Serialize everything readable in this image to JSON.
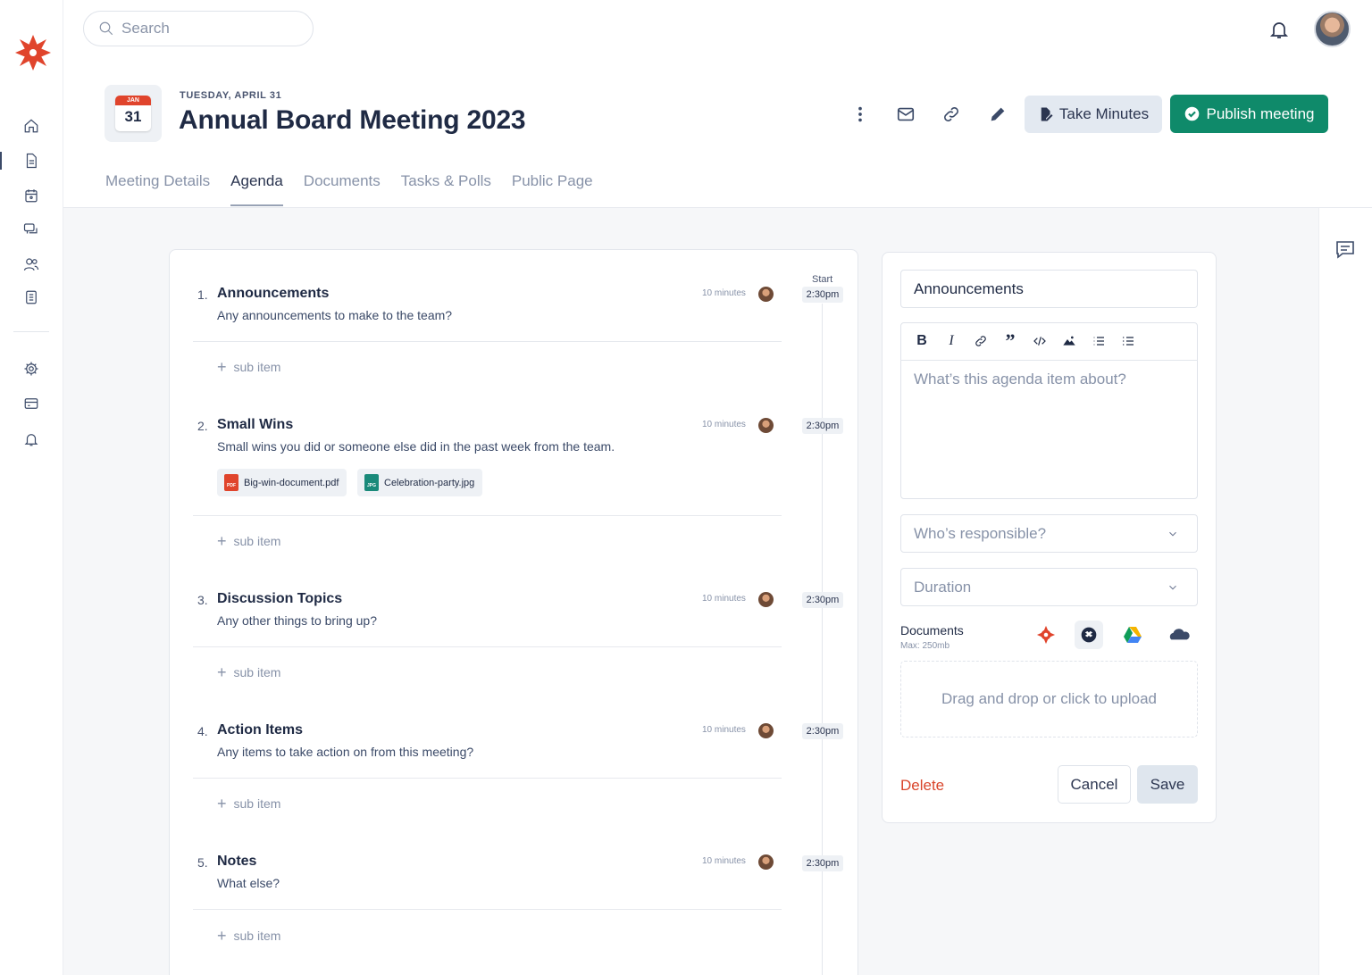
{
  "search": {
    "placeholder": "Search"
  },
  "header": {
    "calendar_month": "JAN",
    "calendar_day": "31",
    "date_label": "TUESDAY, APRIL 31",
    "title": "Annual Board Meeting 2023",
    "take_minutes_label": "Take Minutes",
    "publish_label": "Publish meeting"
  },
  "tabs": [
    {
      "label": "Meeting Details",
      "active": false
    },
    {
      "label": "Agenda",
      "active": true
    },
    {
      "label": "Documents",
      "active": false
    },
    {
      "label": "Tasks & Polls",
      "active": false
    },
    {
      "label": "Public Page",
      "active": false
    }
  ],
  "agenda": {
    "start_label": "Start",
    "sub_item_label": "sub item",
    "items": [
      {
        "num": "1.",
        "title": "Announcements",
        "desc": "Any announcements to make to the team?",
        "duration": "10 minutes",
        "time": "2:30pm"
      },
      {
        "num": "2.",
        "title": "Small Wins",
        "desc": "Small wins you did or someone else did in the past week from the team.",
        "duration": "10 minutes",
        "time": "2:30pm",
        "files": [
          {
            "name": "Big-win-document.pdf",
            "type": "PDF",
            "color": "#e0442c"
          },
          {
            "name": "Celebration-party.jpg",
            "type": "JPG",
            "color": "#1a8a7a"
          }
        ]
      },
      {
        "num": "3.",
        "title": "Discussion Topics",
        "desc": "Any other things to bring up?",
        "duration": "10 minutes",
        "time": "2:30pm"
      },
      {
        "num": "4.",
        "title": "Action Items",
        "desc": "Any items to take action on from this meeting?",
        "duration": "10 minutes",
        "time": "2:30pm"
      },
      {
        "num": "5.",
        "title": "Notes",
        "desc": "What else?",
        "duration": "10 minutes",
        "time": "2:30pm"
      }
    ]
  },
  "editor": {
    "title_value": "Announcements",
    "body_placeholder": "What’s this agenda item about?",
    "responsible_placeholder": "Who’s responsible?",
    "duration_placeholder": "Duration",
    "documents_label": "Documents",
    "documents_max": "Max: 250mb",
    "upload_label": "Drag and drop or click to upload",
    "delete_label": "Delete",
    "cancel_label": "Cancel",
    "save_label": "Save"
  },
  "colors": {
    "brand": "#e0442c",
    "publish": "#0f8a6a",
    "delete": "#d9452b"
  }
}
